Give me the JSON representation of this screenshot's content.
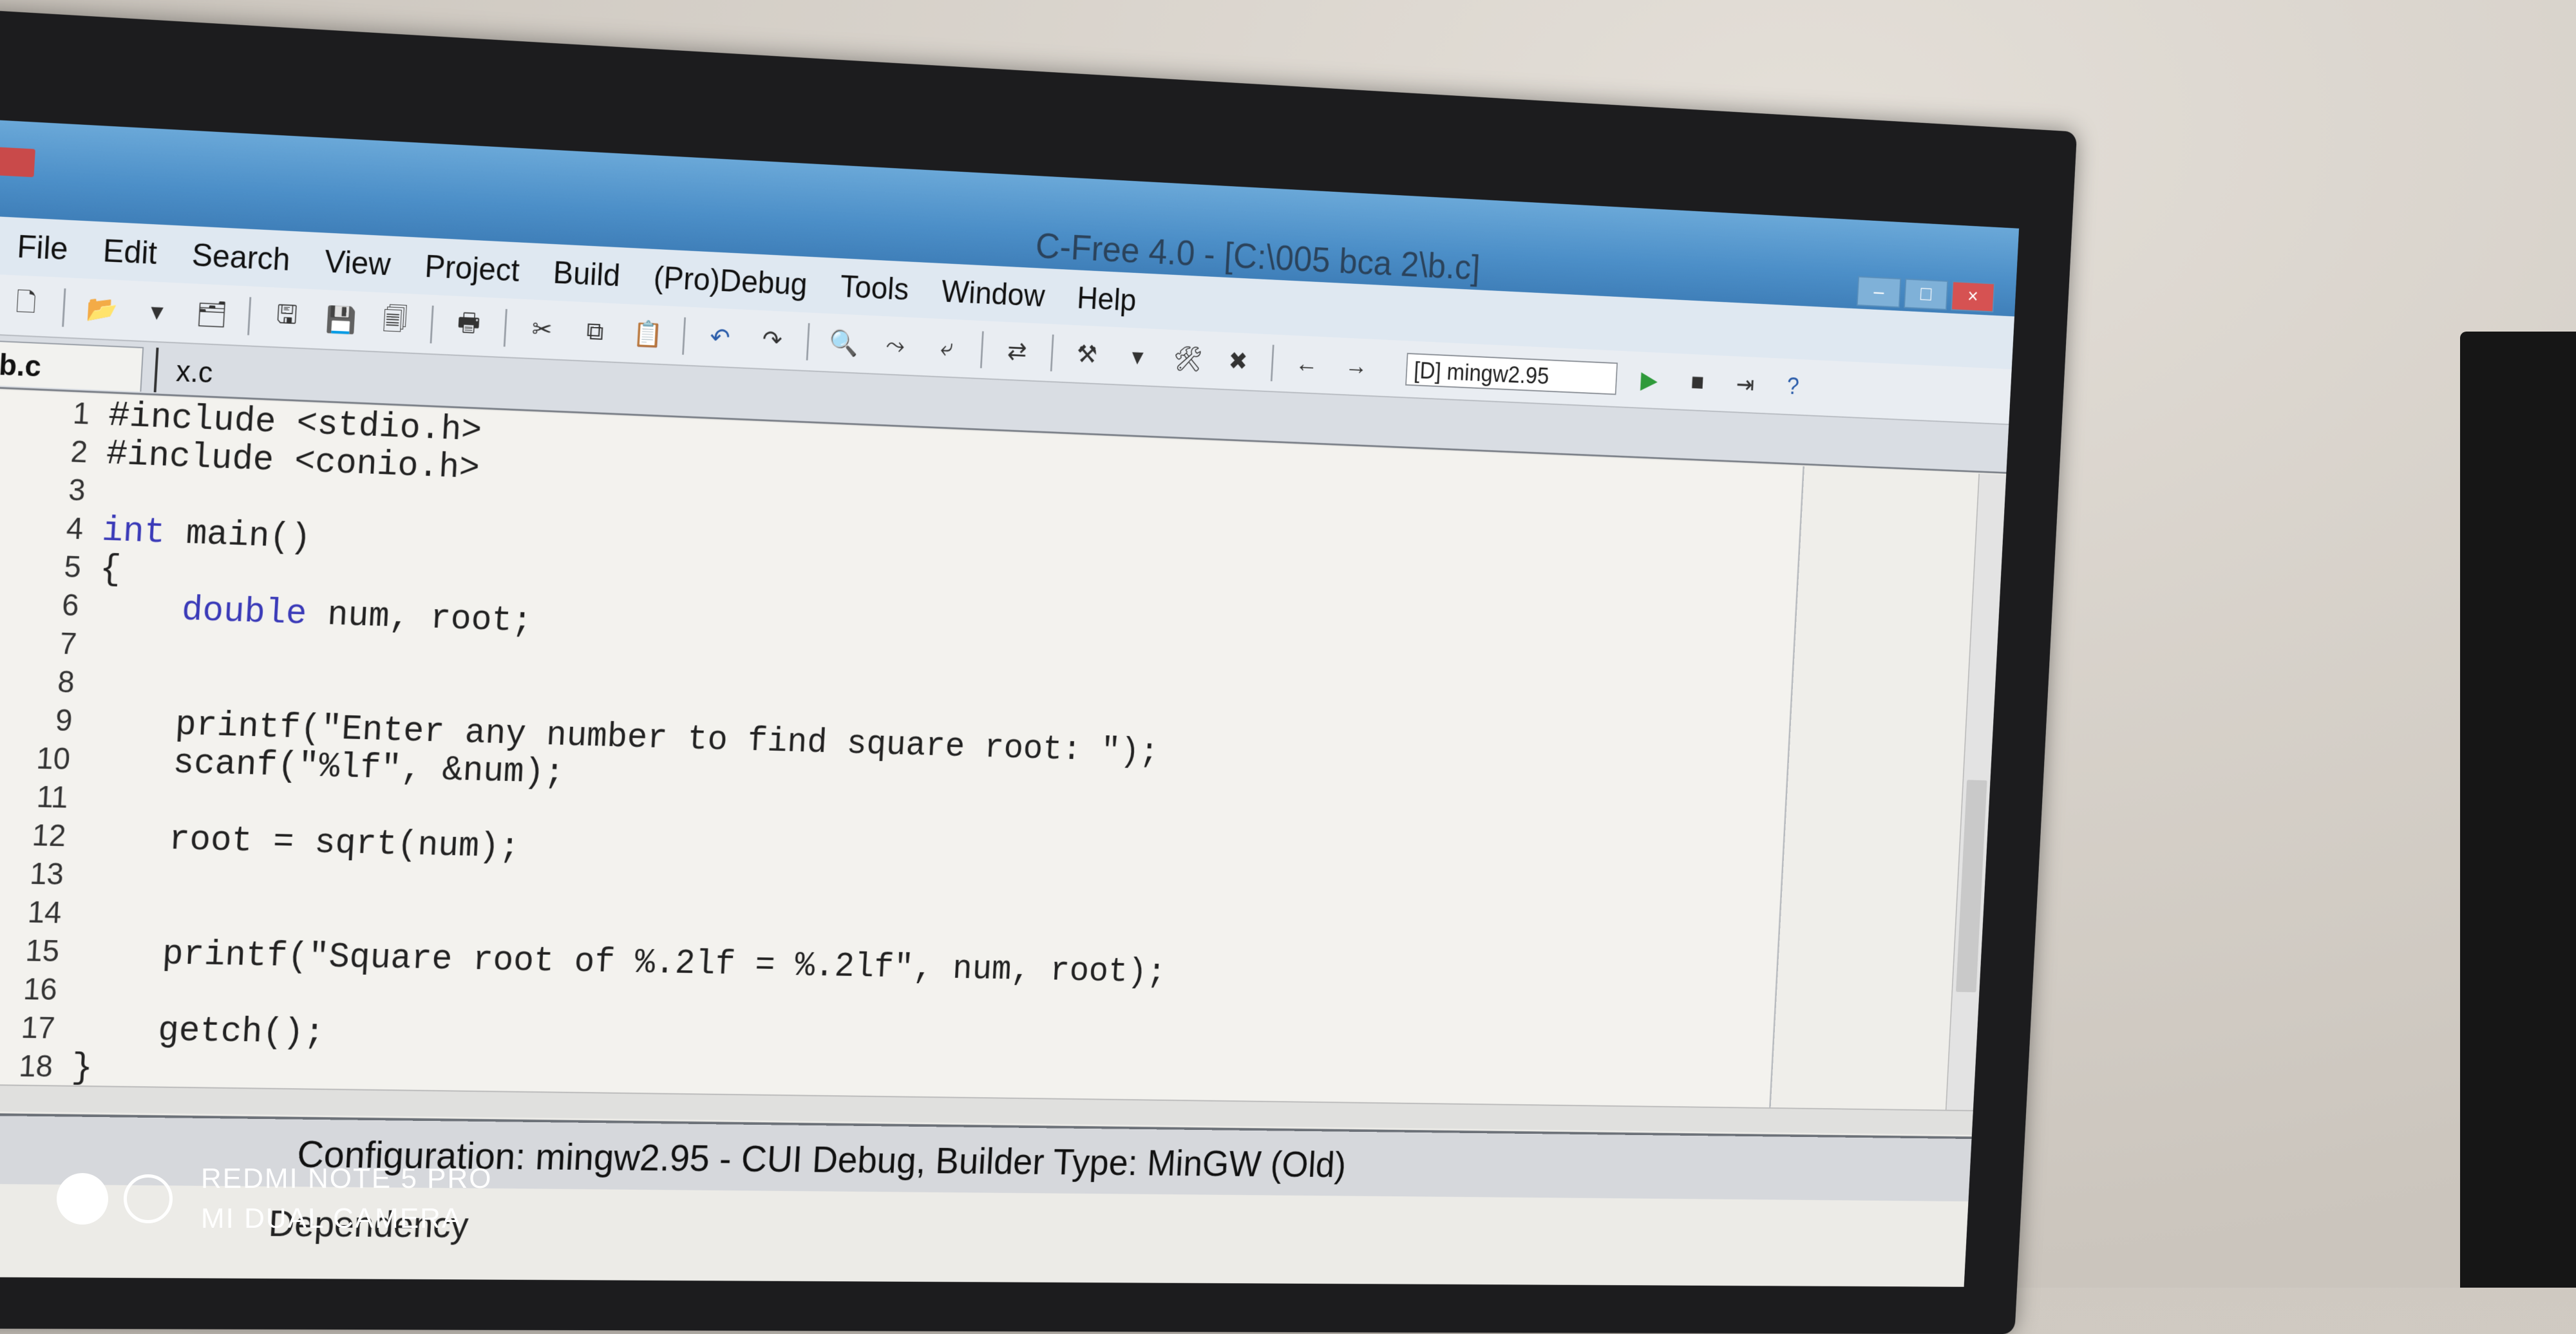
{
  "window": {
    "title": "C-Free 4.0 - [C:\\005 bca 2\\b.c]"
  },
  "menu": [
    "File",
    "Edit",
    "Search",
    "View",
    "Project",
    "Build",
    "(Pro)Debug",
    "Tools",
    "Window",
    "Help"
  ],
  "toolbar": {
    "compiler_select": "[D] mingw2.95"
  },
  "tabs": [
    "b.c",
    "x.c"
  ],
  "code_lines": [
    {
      "num": "1",
      "text": "#include <stdio.h>"
    },
    {
      "num": "2",
      "text": "#include <conio.h>"
    },
    {
      "num": "3",
      "text": ""
    },
    {
      "num": "4",
      "text": "int main()"
    },
    {
      "num": "5",
      "text": "{"
    },
    {
      "num": "6",
      "text": "    double num, root;"
    },
    {
      "num": "7",
      "text": ""
    },
    {
      "num": "8",
      "text": ""
    },
    {
      "num": "9",
      "text": "    printf(\"Enter any number to find square root: \");"
    },
    {
      "num": "10",
      "text": "    scanf(\"%lf\", &num);"
    },
    {
      "num": "11",
      "text": ""
    },
    {
      "num": "12",
      "text": "    root = sqrt(num);"
    },
    {
      "num": "13",
      "text": ""
    },
    {
      "num": "14",
      "text": ""
    },
    {
      "num": "15",
      "text": "    printf(\"Square root of %.2lf = %.2lf\", num, root);"
    },
    {
      "num": "16",
      "text": ""
    },
    {
      "num": "17",
      "text": "    getch();"
    },
    {
      "num": "18",
      "text": "}"
    }
  ],
  "status": {
    "text": "Configuration: mingw2.95 - CUI Debug, Builder Type: MinGW (Old)"
  },
  "bottom_panel_tab": "Dependency",
  "watermark": {
    "line1": "REDMI NOTE 5 PRO",
    "line2": "MI DUAL CAMERA"
  }
}
